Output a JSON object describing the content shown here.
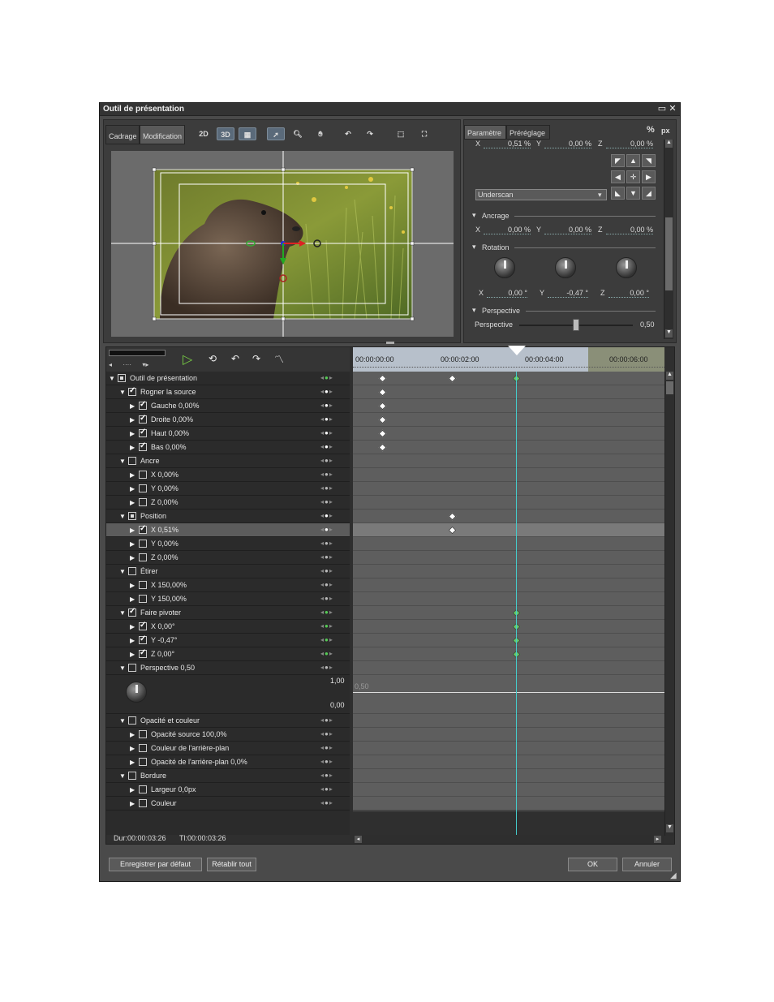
{
  "window": {
    "title": "Outil de présentation"
  },
  "tabs": {
    "crop": "Cadrage",
    "edit": "Modification"
  },
  "toolbar": {
    "btn_2d": "2D",
    "btn_3d": "3D"
  },
  "right_panel": {
    "tab_param": "Paramètre",
    "tab_preset": "Préréglage",
    "unit_pct": "%",
    "unit_px": "px",
    "position": {
      "x_label": "X",
      "x": "0,51 %",
      "y_label": "Y",
      "y": "0,00 %",
      "z_label": "Z",
      "z": "0,00 %"
    },
    "dropdown_value": "Underscan",
    "anchor": {
      "title": "Ancrage",
      "x": "0,00 %",
      "y": "0,00 %",
      "z": "0,00 %"
    },
    "rotation": {
      "title": "Rotation",
      "x": "0,00 °",
      "y": "-0,47 °",
      "z": "0,00 °"
    },
    "perspective": {
      "title": "Perspective",
      "label": "Perspective",
      "value": "0,50",
      "level": 0.5
    }
  },
  "ruler": {
    "t0": "00:00:00:00",
    "t1": "00:00:02:00",
    "t2": "00:00:04:00",
    "t3": "00:00:06:00"
  },
  "tree": [
    {
      "label": "Outil de présentation",
      "kf": "g"
    },
    {
      "label": "Rogner la source",
      "kf": "w"
    },
    {
      "label": "Gauche  0,00%",
      "kf": "w"
    },
    {
      "label": "Droite  0,00%",
      "kf": "w"
    },
    {
      "label": "Haut  0,00%",
      "kf": "w"
    },
    {
      "label": "Bas  0,00%",
      "kf": "w"
    },
    {
      "label": "Ancre",
      "kf": ""
    },
    {
      "label": "X  0,00%",
      "kf": ""
    },
    {
      "label": "Y  0,00%",
      "kf": ""
    },
    {
      "label": "Z  0,00%",
      "kf": ""
    },
    {
      "label": "Position",
      "kf": "w"
    },
    {
      "label": "X  0,51%",
      "kf": "w"
    },
    {
      "label": "Y  0,00%",
      "kf": ""
    },
    {
      "label": "Z  0,00%",
      "kf": ""
    },
    {
      "label": "Étirer",
      "kf": ""
    },
    {
      "label": "X  150,00%",
      "kf": ""
    },
    {
      "label": "Y  150,00%",
      "kf": ""
    },
    {
      "label": "Faire pivoter",
      "kf": "g"
    },
    {
      "label": "X  0,00°",
      "kf": "g"
    },
    {
      "label": "Y  -0,47°",
      "kf": "g"
    },
    {
      "label": "Z  0,00°",
      "kf": "g"
    },
    {
      "label": "Perspective  0,50",
      "kf": ""
    },
    {
      "label": "Opacité et couleur",
      "kf": ""
    },
    {
      "label": "Opacité source  100,0%",
      "kf": ""
    },
    {
      "label": "Couleur de l'arrière-plan",
      "kf": ""
    },
    {
      "label": "Opacité de l'arrière-plan  0,0%",
      "kf": ""
    },
    {
      "label": "Bordure",
      "kf": ""
    },
    {
      "label": "Largeur  0,0px",
      "kf": ""
    },
    {
      "label": "Couleur",
      "kf": ""
    }
  ],
  "perspective_graph": {
    "max": "1,00",
    "min": "0,00",
    "mid": "0,50"
  },
  "status": {
    "dur": "Dur:00:00:03:26",
    "tl": "Tl:00:00:03:26"
  },
  "footer": {
    "save_default": "Enregistrer par défaut",
    "reset_all": "Rétablir tout",
    "ok": "OK",
    "cancel": "Annuler"
  }
}
